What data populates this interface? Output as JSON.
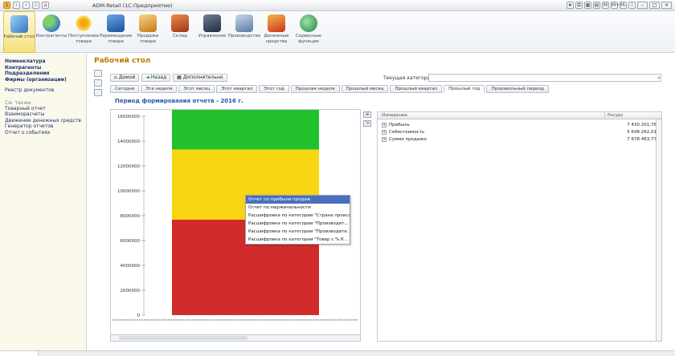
{
  "window": {
    "title": "ADM.Retail (1С:Предприятие)",
    "right_letters": [
      "M",
      "M+",
      "M-"
    ]
  },
  "toolbar": {
    "items": [
      {
        "label": "Рабочий стол",
        "icon": "desktop-icon",
        "color": "#3a8ad1"
      },
      {
        "label": "Контрагенты",
        "icon": "people-icon",
        "color": "#5aa7e0"
      },
      {
        "label": "Поступление товара",
        "icon": "flower-icon",
        "color": "#f2c21b"
      },
      {
        "label": "Перемещение товара",
        "icon": "database-icon",
        "color": "#2d6bb8"
      },
      {
        "label": "Продажи товара",
        "icon": "shopping-cart-icon",
        "color": "#e8a13c"
      },
      {
        "label": "Склад",
        "icon": "warehouse-icon",
        "color": "#c9582b"
      },
      {
        "label": "Управление",
        "icon": "monitor-icon",
        "color": "#3c4d6b"
      },
      {
        "label": "Производство",
        "icon": "tools-icon",
        "color": "#6f8fb3"
      },
      {
        "label": "Денежные средства",
        "icon": "gift-icon",
        "color": "#d04a2a"
      },
      {
        "label": "Сервисные функции",
        "icon": "globe-icon",
        "color": "#2e8a4a"
      }
    ]
  },
  "sidebar": {
    "group1": [
      "Номенклатура",
      "Контрагенты",
      "Подразделения",
      "Фирмы (организации)"
    ],
    "group2": [
      "Реестр документов"
    ],
    "see_also_label": "См. также",
    "group3": [
      "Товарный отчет",
      "Взаиморасчеты",
      "Движение денежных средств",
      "Генератор отчетов",
      "Отчет о событиях"
    ]
  },
  "main": {
    "title": "Рабочий стол",
    "nav": {
      "home": "Домой",
      "back": "Назад",
      "extra": "Дополнительно"
    },
    "category_label": "Текущая категория:",
    "category_value": "",
    "tabs": [
      "Сегодня",
      "Эта неделя",
      "Этот месяц",
      "Этот квартал",
      "Этот год",
      "Прошлая неделя",
      "Прошлый месяц",
      "Прошлый квартал",
      "Прошлый год",
      "Произвольный период"
    ],
    "active_tab": 8,
    "period_title": "Период формирования отчета - 2016 г."
  },
  "chart_data": {
    "type": "bar",
    "stacked": true,
    "y_ticks": [
      "16000000",
      "14000000",
      "12000000",
      "10000000",
      "8000000",
      "6000000",
      "4000000",
      "2000000",
      "0"
    ],
    "ylim": [
      0,
      16000000
    ],
    "categories": [
      ""
    ],
    "series": [
      {
        "name": "Прибыль",
        "values": [
          7430201.76
        ],
        "color": "#22c12d"
      },
      {
        "name": "Себестоимость",
        "values": [
          5648262.01
        ],
        "color": "#f7d611"
      },
      {
        "name": "Сумма продажи",
        "values": [
          7678463.77
        ],
        "color": "#d22b2b"
      }
    ]
  },
  "context_menu": {
    "items": [
      "Отчет по прибыли продаж",
      "Отчет по маржинальности",
      "Расшифровка по категории \"Страна происх...",
      "Расшифровка по категории \"Производит...",
      "Расшифровка по категории \"Производите...",
      "Расшифровка по категории \"Товар с % К..."
    ],
    "selected": 0
  },
  "table": {
    "headers": [
      "Измерение",
      "Ресурс"
    ],
    "rows": [
      {
        "name": "Прибыль",
        "value": "7 430 201,76"
      },
      {
        "name": "Себестоимость",
        "value": "5 648 262,01"
      },
      {
        "name": "Сумма продажи",
        "value": "7 678 463,77"
      }
    ]
  }
}
